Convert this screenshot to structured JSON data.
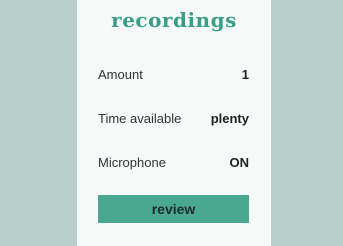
{
  "header": {
    "title": "recordings"
  },
  "settings": {
    "amount": {
      "label": "Amount",
      "value": "1"
    },
    "time_available": {
      "label": "Time available",
      "value": "plenty"
    },
    "microphone": {
      "label": "Microphone",
      "value": "ON"
    }
  },
  "actions": {
    "review_label": "review"
  },
  "colors": {
    "background": "#b8cfcb",
    "panel": "#f5f9f8",
    "accent": "#3a9e87",
    "button": "#4aa891"
  }
}
